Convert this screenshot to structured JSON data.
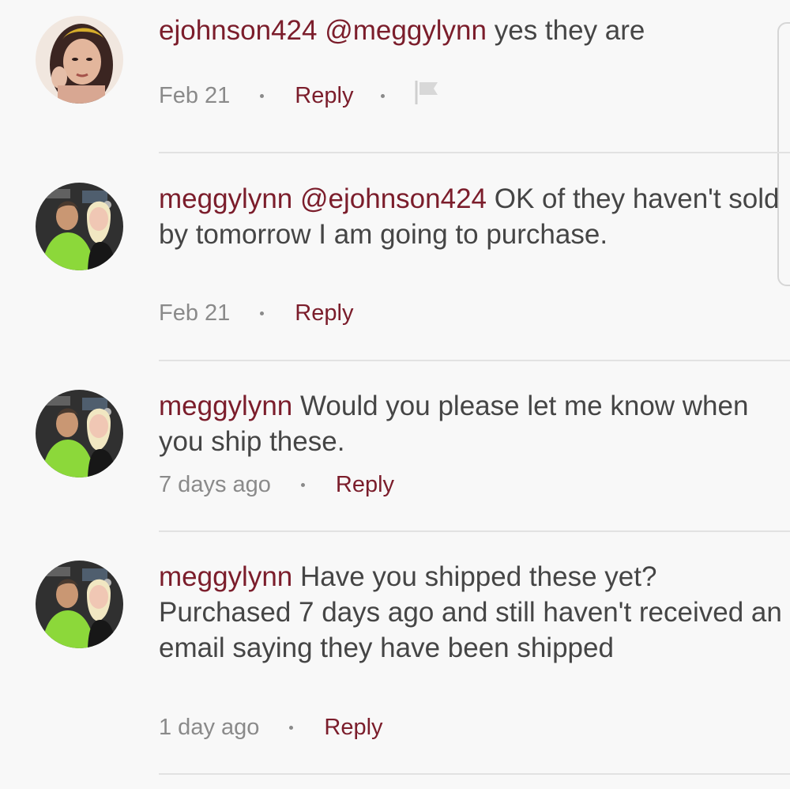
{
  "comments": [
    {
      "username": "ejohnson424",
      "mention": "@meggylynn",
      "text": "yes they are",
      "timestamp": "Feb 21",
      "reply_label": "Reply",
      "avatar_icon": "user-avatar-woman",
      "flag_icon": "flag-icon"
    },
    {
      "username": "meggylynn",
      "mention": "@ejohnson424",
      "text": "OK of they haven't sold by tomorrow I am going to purchase.",
      "timestamp": "Feb 21",
      "reply_label": "Reply",
      "avatar_icon": "user-avatar-couple"
    },
    {
      "username": "meggylynn",
      "text": "Would you please let me know when you ship these.",
      "timestamp": "7 days ago",
      "reply_label": "Reply",
      "avatar_icon": "user-avatar-couple"
    },
    {
      "username": "meggylynn",
      "text": "Have you shipped these yet? Purchased 7 days ago and still haven't received an email saying they have been shipped",
      "timestamp": "1 day ago",
      "reply_label": "Reply",
      "avatar_icon": "user-avatar-couple"
    }
  ],
  "colors": {
    "accent": "#7b1d2b",
    "text": "#454545",
    "meta": "#8a8a8a",
    "divider": "#e2e2e2",
    "background": "#f8f8f8"
  }
}
